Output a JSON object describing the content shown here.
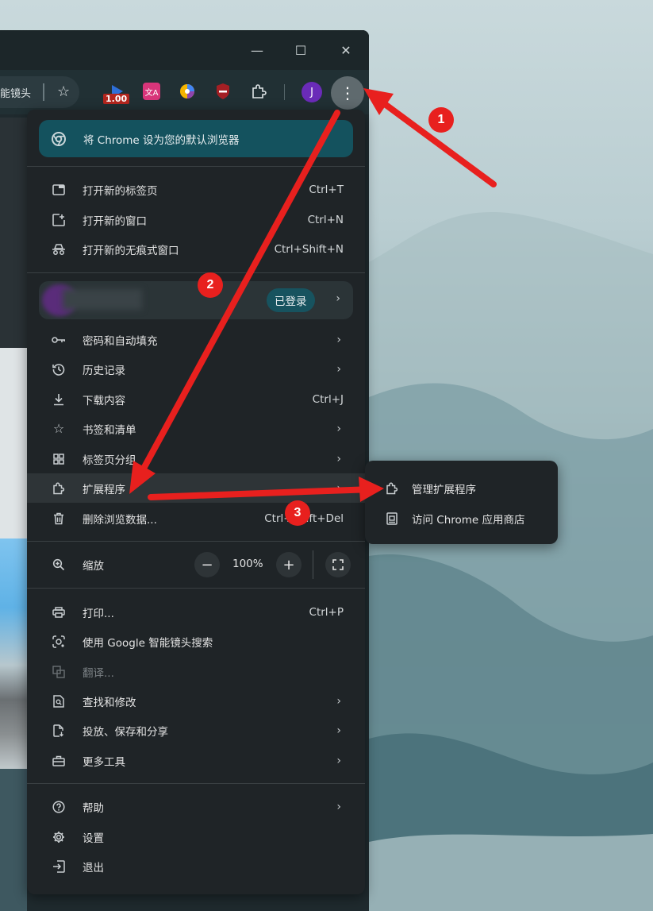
{
  "window": {
    "minimize_glyph": "—",
    "maximize_glyph": "☐",
    "close_glyph": "✕"
  },
  "toolbar": {
    "address_text": "能镜头",
    "extension_badge": "1.00",
    "avatar_letter": "J",
    "menu_glyph": "⋮"
  },
  "menu": {
    "promo_label": "将 Chrome 设为您的默认浏览器",
    "items_group1": [
      {
        "label": "打开新的标签页",
        "shortcut": "Ctrl+T"
      },
      {
        "label": "打开新的窗口",
        "shortcut": "Ctrl+N"
      },
      {
        "label": "打开新的无痕式窗口",
        "shortcut": "Ctrl+Shift+N"
      }
    ],
    "profile": {
      "signed_in_label": "已登录"
    },
    "items_group2": [
      {
        "label": "密码和自动填充"
      },
      {
        "label": "历史记录"
      },
      {
        "label": "下载内容",
        "shortcut": "Ctrl+J"
      },
      {
        "label": "书签和清单"
      },
      {
        "label": "标签页分组"
      },
      {
        "label": "扩展程序"
      },
      {
        "label": "删除浏览数据...",
        "shortcut": "Ctrl+Shift+Del"
      }
    ],
    "zoom": {
      "label": "缩放",
      "minus": "−",
      "value": "100%",
      "plus": "+"
    },
    "items_group3": [
      {
        "label": "打印...",
        "shortcut": "Ctrl+P"
      },
      {
        "label": "使用 Google 智能镜头搜索"
      },
      {
        "label": "翻译..."
      },
      {
        "label": "查找和修改"
      },
      {
        "label": "投放、保存和分享"
      },
      {
        "label": "更多工具"
      }
    ],
    "items_group4": [
      {
        "label": "帮助"
      },
      {
        "label": "设置"
      },
      {
        "label": "退出"
      }
    ]
  },
  "submenu": {
    "items": [
      {
        "label": "管理扩展程序"
      },
      {
        "label": "访问 Chrome 应用商店"
      }
    ]
  },
  "annotations": {
    "step1": "1",
    "step2": "2",
    "step3": "3",
    "color": "#e8201e"
  }
}
